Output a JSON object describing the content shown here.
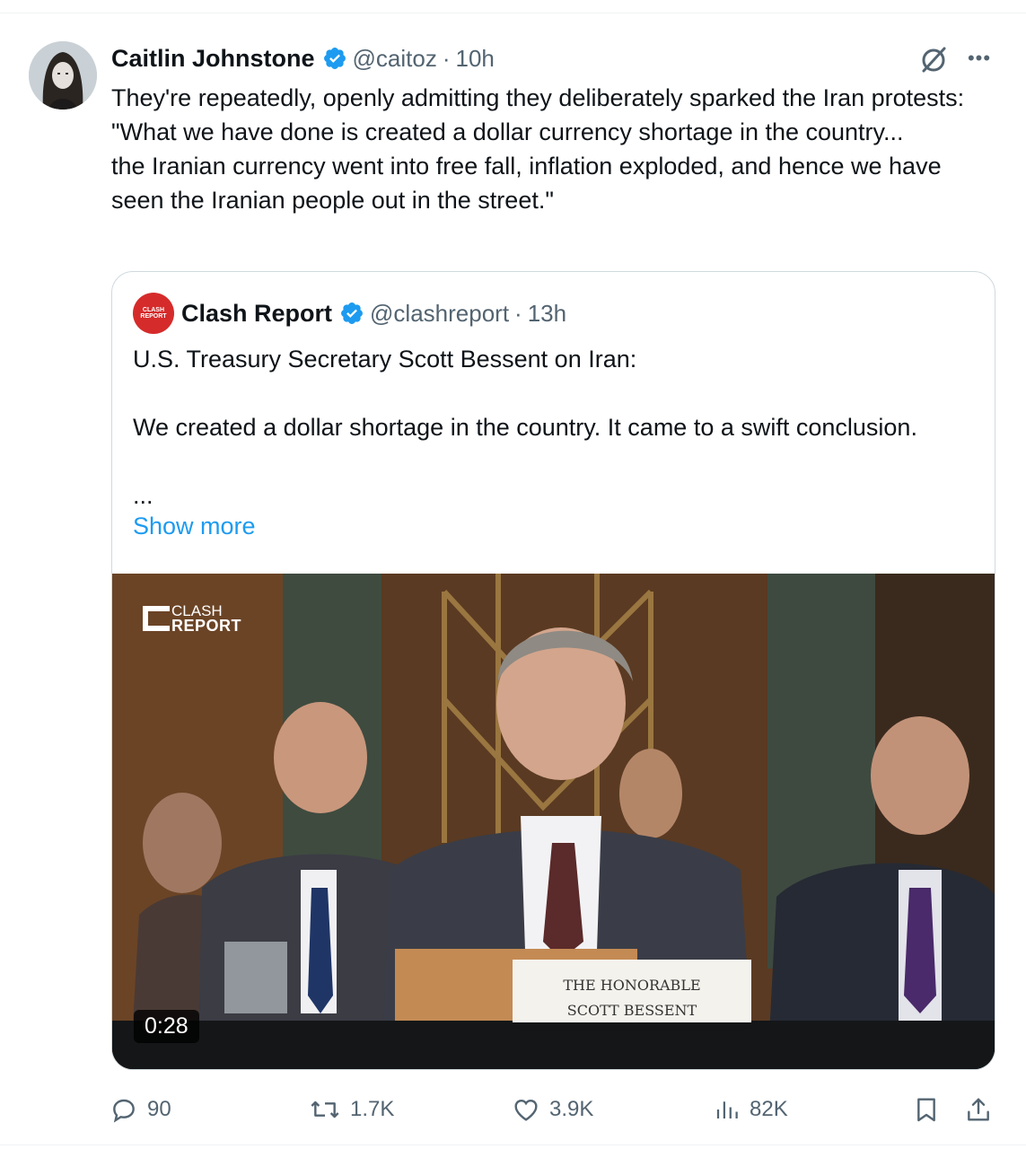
{
  "tweet": {
    "author_name": "Caitlin Johnstone",
    "handle": "@caitoz",
    "separator": "·",
    "time": "10h",
    "text": "They're repeatedly, openly admitting they deliberately sparked the Iran protests:\n\"What we have done is created a dollar currency shortage in the country...\nthe Iranian currency went into free fall, inflation exploded, and hence we have seen the Iranian people out in the street.\""
  },
  "quote": {
    "author_name": "Clash Report",
    "handle": "@clashreport",
    "separator": "·",
    "time": "13h",
    "text": "U.S. Treasury Secretary Scott Bessent on Iran:\n\nWe created a dollar shortage in the country. It came to a swift conclusion.\n\n...",
    "show_more": "Show more",
    "video": {
      "duration": "0:28",
      "watermark_top": "CLASH",
      "watermark_bottom": "REPORT",
      "nameplate_line1": "THE HONORABLE",
      "nameplate_line2": "SCOTT BESSENT"
    }
  },
  "actions": {
    "replies": "90",
    "reposts": "1.7K",
    "likes": "3.9K",
    "views": "82K"
  },
  "colors": {
    "verified": "#1d9bf0",
    "muted": "#536471",
    "link": "#1d9bf0"
  }
}
